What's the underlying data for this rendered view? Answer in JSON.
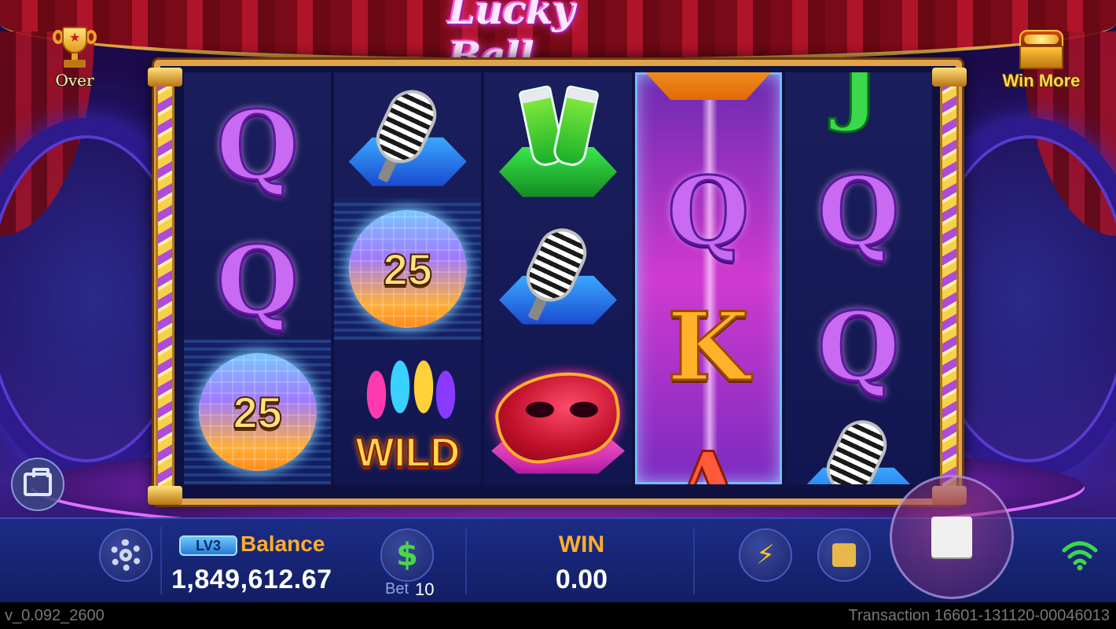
{
  "game": {
    "logo": "Lucky Ball"
  },
  "top": {
    "over_label": "Over",
    "win_more_label": "Win More"
  },
  "reels": [
    [
      "Q",
      "Q",
      "25"
    ],
    [
      "mic",
      "25",
      "WILD"
    ],
    [
      "champagne",
      "mic",
      "mask"
    ],
    [
      "sax",
      "Q",
      "K",
      "A"
    ],
    [
      "J",
      "Q",
      "Q",
      "mic"
    ]
  ],
  "symbols": {
    "q": "Q",
    "k": "K",
    "j": "J",
    "a": "A",
    "disco_value": "25",
    "wild": "WILD"
  },
  "panel": {
    "level": "LV3",
    "balance_label": "Balance",
    "balance_value": "1,849,612.67",
    "bet_symbol": "$",
    "bet_label": "Bet",
    "bet_value": "10",
    "win_label": "WIN",
    "win_value": "0.00",
    "bolt_symbol": "⚡"
  },
  "footer": {
    "version": "v_0.092_2600",
    "transaction": "Transaction 16601-131120-00046013"
  },
  "icons": [
    "trophy-icon",
    "treasure-chest-icon",
    "bag-icon",
    "gear-icon",
    "dollar-icon",
    "bolt-icon",
    "auto-square-icon",
    "stop-icon",
    "wifi-icon"
  ],
  "colors": {
    "accent_gold": "#ffae2a",
    "frame_gold": "#e2a44a",
    "panel_blue": "#1c2c86",
    "q_purple": "#c86af2",
    "k_orange": "#ffb12a",
    "wifi_green": "#3ad84a"
  }
}
